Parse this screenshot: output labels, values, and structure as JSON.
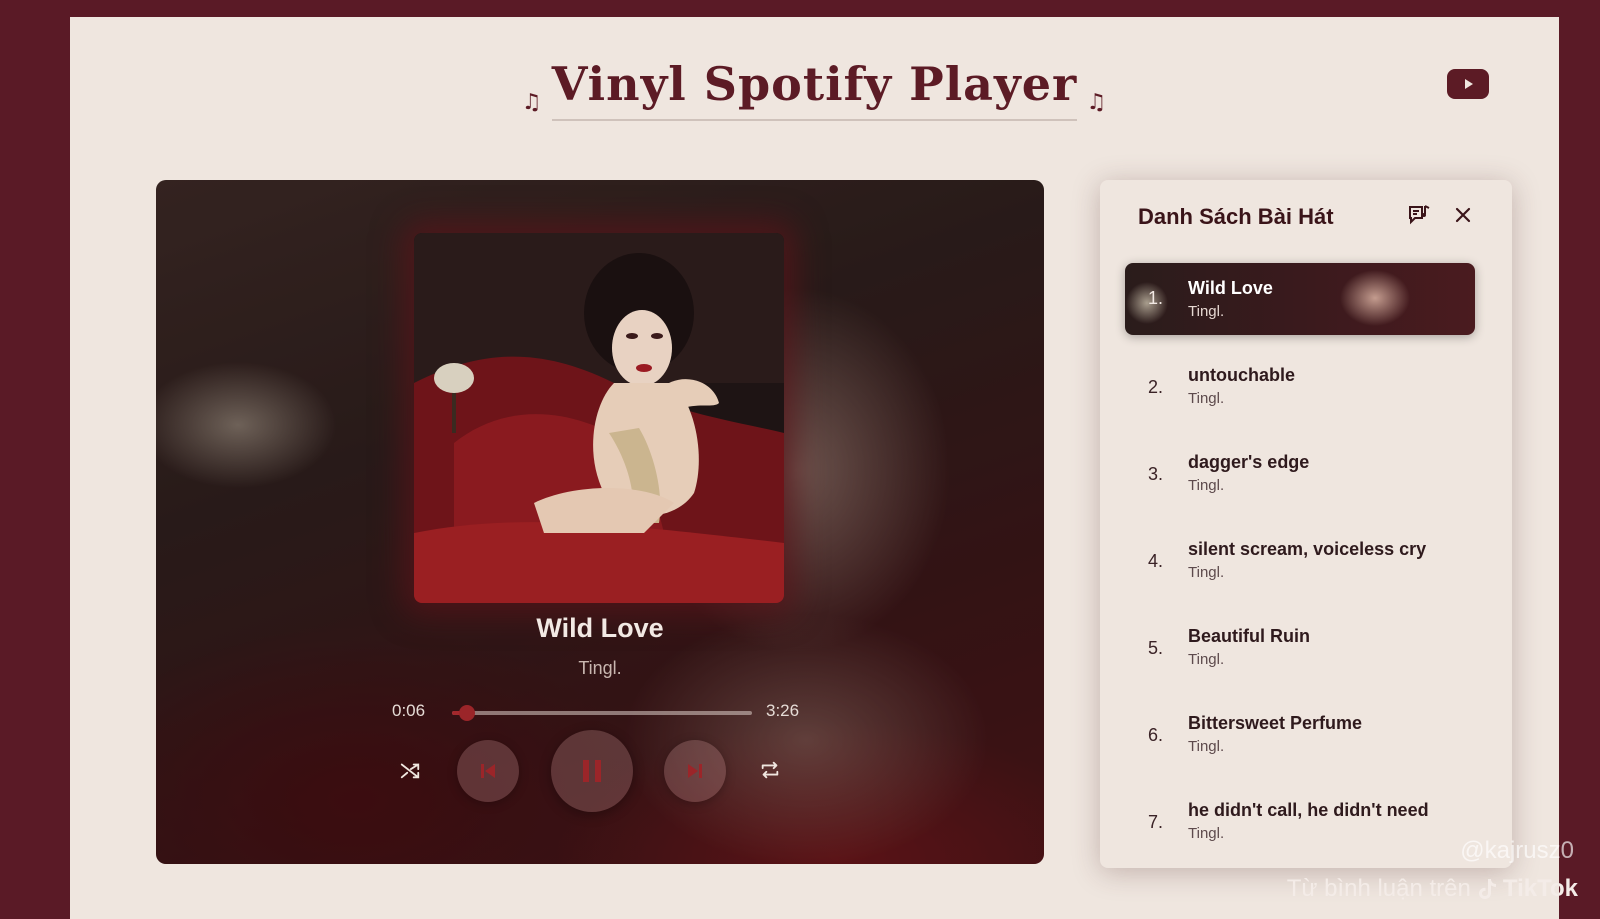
{
  "header": {
    "title": "Vinyl Spotify Player",
    "note_glyph": "♫"
  },
  "player": {
    "track_title": "Wild Love",
    "artist": "Tingl.",
    "current_time": "0:06",
    "duration": "3:26",
    "progress": 0.05
  },
  "playlist": {
    "title": "Danh Sách Bài Hát",
    "items": [
      {
        "num": "1.",
        "name": "Wild Love",
        "artist": "Tingl."
      },
      {
        "num": "2.",
        "name": "untouchable",
        "artist": "Tingl."
      },
      {
        "num": "3.",
        "name": "dagger's edge",
        "artist": "Tingl."
      },
      {
        "num": "4.",
        "name": "silent scream, voiceless cry",
        "artist": "Tingl."
      },
      {
        "num": "5.",
        "name": "Beautiful Ruin",
        "artist": "Tingl."
      },
      {
        "num": "6.",
        "name": "Bittersweet Perfume",
        "artist": "Tingl."
      },
      {
        "num": "7.",
        "name": "he didn't call, he didn't need",
        "artist": "Tingl."
      }
    ]
  },
  "watermark": {
    "handle": "@kajrusz0",
    "caption": "Từ bình luận trên",
    "brand": "TikTok"
  },
  "colors": {
    "background": "#5a1a26",
    "page": "#efe6df",
    "accent": "#9b2529"
  },
  "icons": [
    "youtube-icon",
    "shuffle-icon",
    "previous-icon",
    "pause-icon",
    "next-icon",
    "repeat-icon",
    "queue-music-icon",
    "close-icon",
    "tiktok-icon"
  ]
}
